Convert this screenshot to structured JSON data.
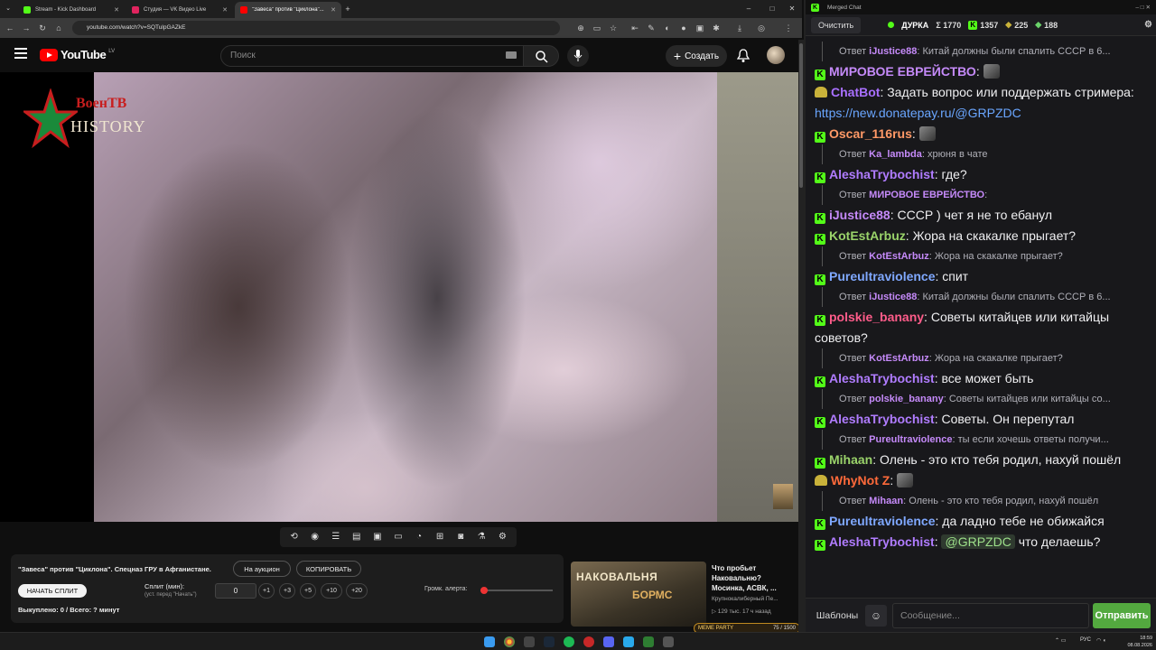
{
  "browser": {
    "tabs": [
      {
        "label": "Stream - Kick Dashboard",
        "color": "#53fc18"
      },
      {
        "label": "Студия — VK Видео Live",
        "color": "#e0245e"
      },
      {
        "label": "\"Завеса\" против \"Циклона\"...",
        "color": "#ff0000"
      }
    ],
    "url": "youtube.com/watch?v=SQTulpGAZkE"
  },
  "youtube": {
    "logo_text": "YouTube",
    "region": "LV",
    "search_placeholder": "Поиск",
    "create_label": "Создать"
  },
  "video": {
    "watermark_line1": "ВоенТВ",
    "watermark_line2": "HISTORY"
  },
  "panel": {
    "title": "\"Завеса\" против \"Циклона\". Спецназ ГРУ в Афганистане.",
    "auction_label": "На аукцион",
    "copy_label": "КОПИРОВАТЬ",
    "start_split_label": "НАЧАТЬ СПЛИТ",
    "split_label": "Сплит (мин):",
    "split_hint": "(уст. перед \"Начать\")",
    "split_value": "0",
    "steps": [
      "+1",
      "+3",
      "+5",
      "+10",
      "+20"
    ],
    "bought_label": "Выкуплено: 0 / Всего: ? минут",
    "alert_volume_label": "Громк. алерта:",
    "alert_volume": 0.05
  },
  "recommendation": {
    "thumb_text": "НАКОВАЛЬНЯ",
    "thumb_text2": "БОРМС",
    "title": "Что пробьет Наковальню? Мосинка, АСВК, ...",
    "channel": "Крупнокалиберный Пе...",
    "meta": "▷ 129 тыс.  17 ч назад"
  },
  "meme_party": {
    "label": "МЕМЕ PARTY",
    "progress": "75 / 1500"
  },
  "chat": {
    "window_title": "Merged Chat",
    "clear_label": "Очистить",
    "channel_name": "ДУРКА",
    "total": "Σ 1770",
    "kick_count": "1357",
    "viewers_2": "225",
    "viewers_3": "188",
    "templates_label": "Шаблоны",
    "input_placeholder": "Сообщение...",
    "send_label": "Отправить",
    "messages": [
      {
        "kind": "reply",
        "prefix": "Ответ",
        "user": "iJustice88",
        "text": ": Китай должны были спалить СССР в 6..."
      },
      {
        "kind": "msg",
        "platform": "kick",
        "user": "МИРОВОЕ ЕВРЕЙСТВО",
        "color": "#c58af9",
        "text": ""
      },
      {
        "kind": "msg",
        "platform": "bot",
        "user": "ChatBot",
        "color": "#a970ff",
        "text": "Задать вопрос или поддержать стримера: ",
        "link": "https://new.donatepay.ru/@GRPZDC"
      },
      {
        "kind": "msg",
        "platform": "kick",
        "user": "Oscar_116rus",
        "color": "#ff9966",
        "text": ""
      },
      {
        "kind": "reply",
        "prefix": "Ответ",
        "user": "Ka_lambda",
        "text": ": хрюня в чате"
      },
      {
        "kind": "msg",
        "platform": "kick",
        "user": "AleshaTrybochist",
        "color": "#b07cff",
        "text": "где?"
      },
      {
        "kind": "reply",
        "prefix": "Ответ",
        "user": "МИРОВОЕ ЕВРЕЙСТВО",
        "text": ":"
      },
      {
        "kind": "msg",
        "platform": "kick",
        "user": "iJustice88",
        "color": "#c58af9",
        "text": "СССР ) чет я не то ебанул"
      },
      {
        "kind": "msg",
        "platform": "kick",
        "user": "KotEstArbuz",
        "color": "#9ad36a",
        "text": "Жора на скакалке прыгает?"
      },
      {
        "kind": "reply",
        "prefix": "Ответ",
        "user": "KotEstArbuz",
        "text": ": Жора на скакалке прыгает?"
      },
      {
        "kind": "msg",
        "platform": "kick",
        "user": "Pureultraviolence",
        "color": "#7fa8ff",
        "text": "спит"
      },
      {
        "kind": "reply",
        "prefix": "Ответ",
        "user": "iJustice88",
        "text": ": Китай должны были спалить СССР в 6..."
      },
      {
        "kind": "msg",
        "platform": "kick",
        "user": "polskie_banany",
        "color": "#ff5c8a",
        "text": "Советы китайцев или китайцы советов?"
      },
      {
        "kind": "reply",
        "prefix": "Ответ",
        "user": "KotEstArbuz",
        "text": ": Жора на скакалке прыгает?"
      },
      {
        "kind": "msg",
        "platform": "kick",
        "user": "AleshaTrybochist",
        "color": "#b07cff",
        "text": "все может быть"
      },
      {
        "kind": "reply",
        "prefix": "Ответ",
        "user": "polskie_banany",
        "text": ": Советы китайцев или китайцы со..."
      },
      {
        "kind": "msg",
        "platform": "kick",
        "user": "AleshaTrybochist",
        "color": "#b07cff",
        "text": "Советы. Он перепутал"
      },
      {
        "kind": "reply",
        "prefix": "Ответ",
        "user": "Pureultraviolence",
        "text": ": ты если хочешь ответы получи..."
      },
      {
        "kind": "msg",
        "platform": "kick",
        "user": "Mihaan",
        "color": "#9ad36a",
        "text": "Олень - это кто тебя родил, нахуй пошёл"
      },
      {
        "kind": "msg",
        "platform": "bot",
        "user": "WhyNot Z",
        "color": "#ff6a3a",
        "text": ""
      },
      {
        "kind": "reply",
        "prefix": "Ответ",
        "user": "Mihaan",
        "text": ": Олень - это кто тебя родил, нахуй пошёл"
      },
      {
        "kind": "msg",
        "platform": "kick",
        "user": "Pureultraviolence",
        "color": "#7fa8ff",
        "text": "да ладно тебе не обижайся"
      },
      {
        "kind": "msg",
        "platform": "kick",
        "user": "AleshaTrybochist",
        "color": "#b07cff",
        "text": "что делаешь?",
        "mention": "@GRPZDC"
      }
    ]
  },
  "taskbar": {
    "lang": "РУС",
    "time": "18:59",
    "date": "08.08.2026"
  }
}
